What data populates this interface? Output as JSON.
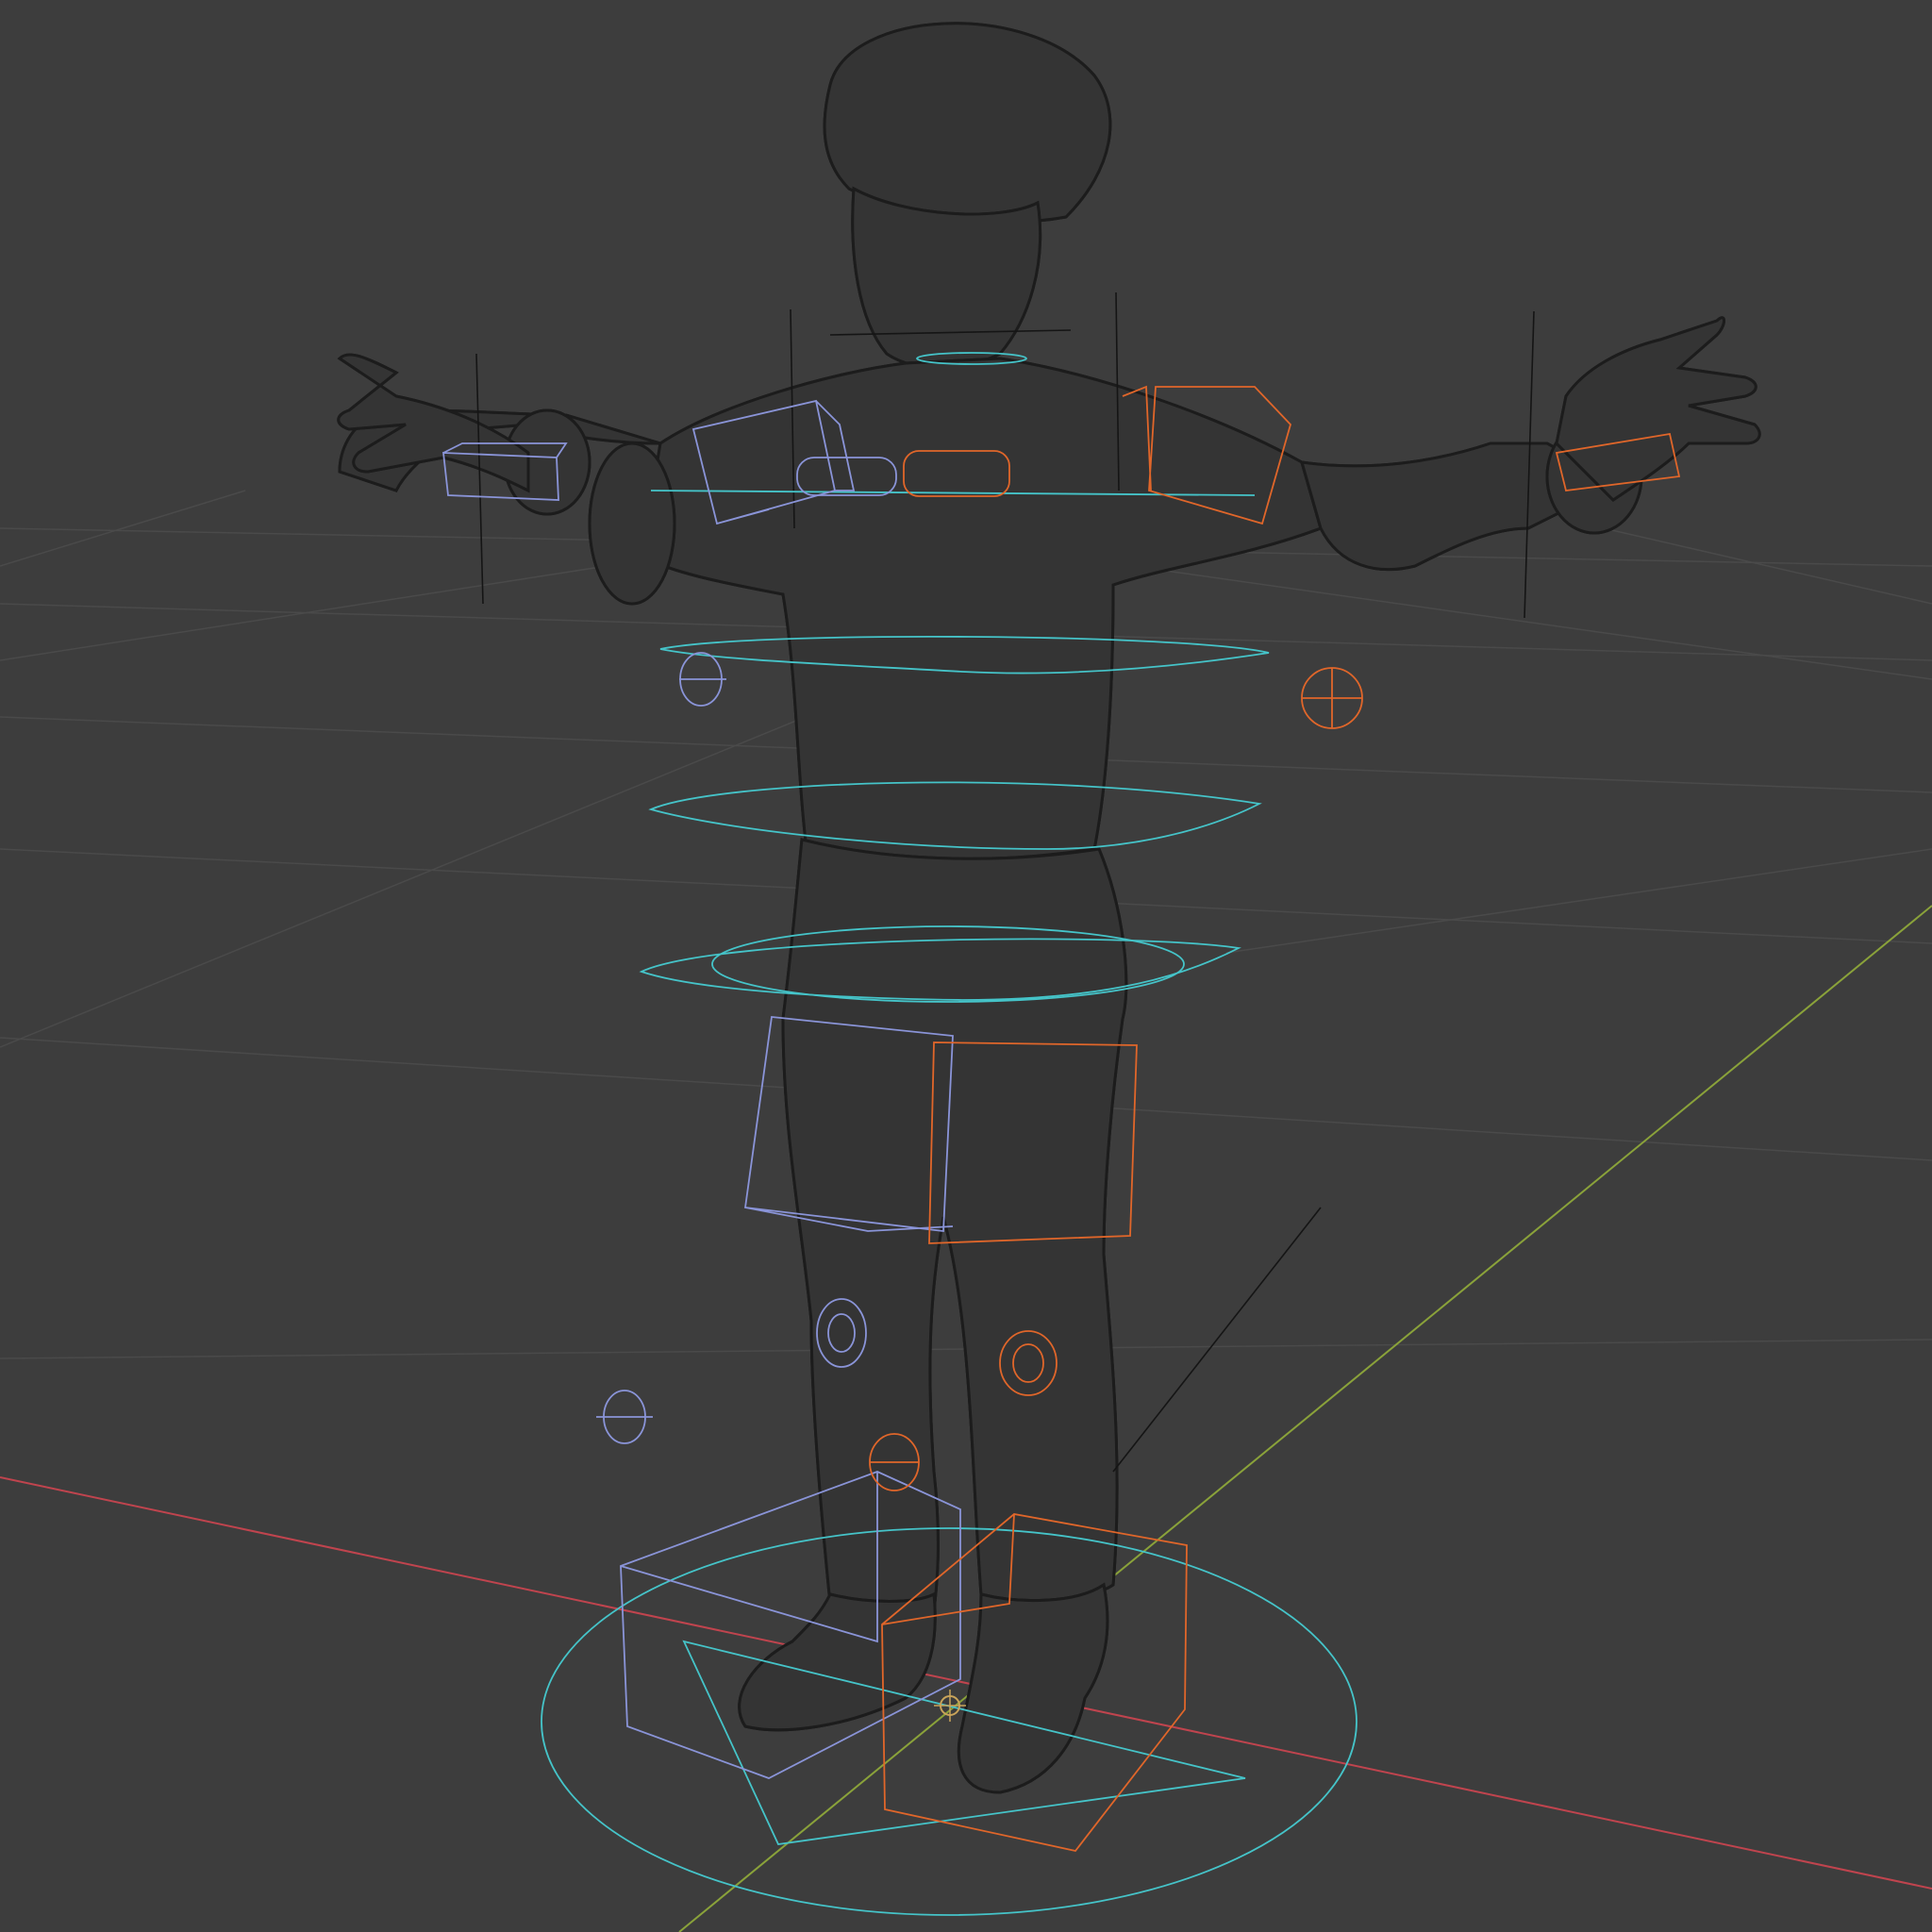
{
  "viewport": {
    "mode": "wireframe",
    "background": "#3d3d3d",
    "grid_color": "#4a4a4a",
    "axis_x_color": "#c0444e",
    "axis_y_color": "#8aa23a",
    "mesh_wire_color": "#1c1c1c",
    "rig_colors": {
      "center": "#45c4c9",
      "left": "#8a94d8",
      "right": "#e0662a"
    }
  },
  "scene": {
    "object": "character-mesh",
    "pose": "t-pose",
    "rig_controls": [
      "neck-ring",
      "chest-ring",
      "spine-ring",
      "hips-ring",
      "root-circle",
      "shoulder-box-left",
      "shoulder-box-right",
      "hand-box-left",
      "hand-box-right",
      "thigh-box-left",
      "thigh-box-right",
      "foot-box-left",
      "foot-box-right",
      "elbow-pole-left",
      "elbow-pole-right",
      "knee-pole-left",
      "knee-pole-right"
    ]
  }
}
